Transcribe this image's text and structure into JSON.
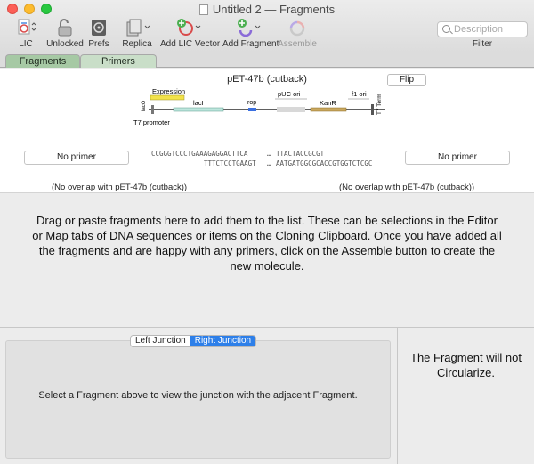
{
  "window": {
    "title": "Untitled 2 — Fragments"
  },
  "toolbar": {
    "lic": "LIC",
    "unlocked": "Unlocked",
    "prefs": "Prefs",
    "replica": "Replica",
    "add_lic_vector": "Add LIC Vector",
    "add_fragment": "Add Fragment",
    "assemble": "Assemble",
    "search_placeholder": "Description",
    "filter": "Filter"
  },
  "tabs": {
    "fragments": "Fragments",
    "primers": "Primers"
  },
  "fragment": {
    "name": "pET-47b (cutback)",
    "flip": "Flip",
    "features": {
      "expression": "Expression",
      "puc_ori": "pUC ori",
      "f1_ori": "f1 ori",
      "t7_term": "T7 Term",
      "laci": "lacI",
      "rop": "rop",
      "kanr": "KanR",
      "lacO": "lacO",
      "t7_promoter": "T7 promoter"
    },
    "left_primer": "No primer",
    "right_primer": "No primer",
    "seq_left_top": "CCGGGTCCCTGAAAGAGGACTTCA",
    "seq_left_bottom": "TTTCTCCTGAAGT",
    "seq_right_top": "TTACTACCGCGT",
    "seq_right_bottom": "AATGATGGCGCACCGTGGTCTCGC",
    "ellipsis": "…",
    "left_overlap": "(No overlap with pET-47b (cutback))",
    "right_overlap": "(No overlap with pET-47b (cutback))"
  },
  "dropzone": {
    "text": "Drag or paste fragments here to add them to the list. These can be selections in the Editor or Map tabs of DNA sequences or items on the Cloning Clipboard.  Once you have added all the fragments and are happy with any primers, click on the Assemble button to create the new molecule."
  },
  "junction": {
    "left_tab": "Left Junction",
    "right_tab": "Right Junction",
    "message": "Select a Fragment above to view the junction with the adjacent Fragment."
  },
  "circularize": {
    "message": "The Fragment will not Circularize."
  },
  "colors": {
    "tab_active": "#a6c9a4",
    "tab_inactive": "#c9dec8",
    "segment_selected": "#2d7fe9"
  }
}
